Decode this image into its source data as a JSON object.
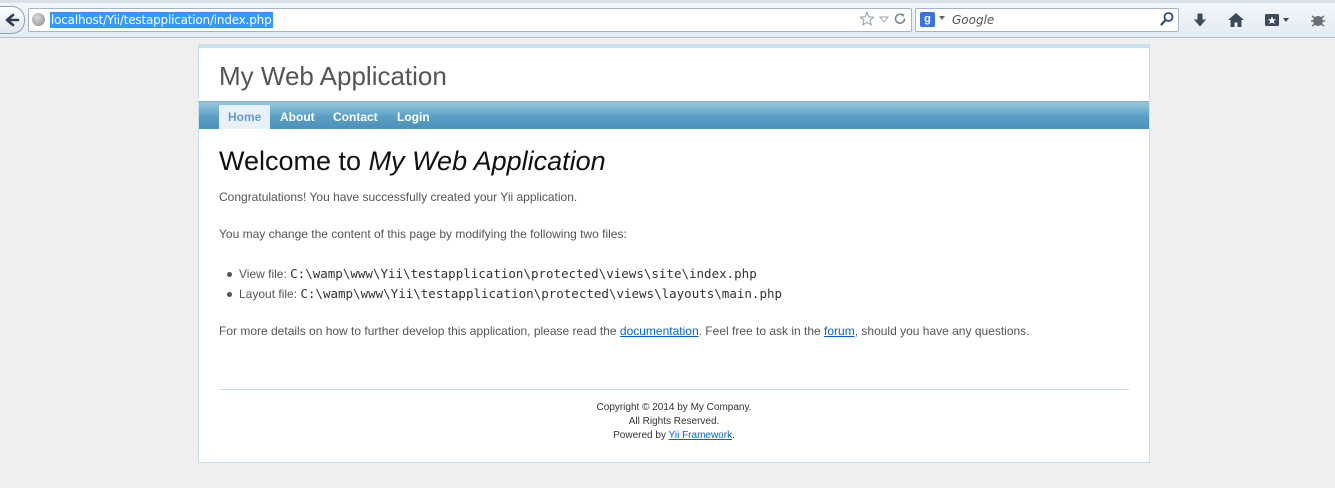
{
  "browser": {
    "address": "localhost/Yii/testapplication/index.php",
    "search_placeholder": "Google",
    "search_engine_letter": "g"
  },
  "site": {
    "logo": "My Web Application",
    "menu": [
      {
        "label": "Home",
        "active": true
      },
      {
        "label": "About"
      },
      {
        "label": "Contact"
      },
      {
        "label": "Login"
      }
    ]
  },
  "content": {
    "heading_prefix": "Welcome to ",
    "heading_app": "My Web Application",
    "congrats": "Congratulations! You have successfully created your Yii application.",
    "change_intro": "You may change the content of this page by modifying the following two files:",
    "files": [
      {
        "label": "View file: ",
        "path": "C:\\wamp\\www\\Yii\\testapplication\\protected\\views\\site\\index.php"
      },
      {
        "label": "Layout file: ",
        "path": "C:\\wamp\\www\\Yii\\testapplication\\protected\\views\\layouts\\main.php"
      }
    ],
    "details_before": "For more details on how to further develop this application, please read the ",
    "documentation_link": "documentation",
    "details_middle": ". Feel free to ask in the ",
    "forum_link": "forum",
    "details_after": ", should you have any questions."
  },
  "footer": {
    "copyright": "Copyright © 2014 by My Company.",
    "rights": "All Rights Reserved.",
    "powered_prefix": "Powered by ",
    "framework_link": "Yii Framework",
    "powered_suffix": "."
  },
  "colors": {
    "menu_bar": "#5a9ec3",
    "link": "#0066cc",
    "url_highlight": "#3399ff"
  }
}
